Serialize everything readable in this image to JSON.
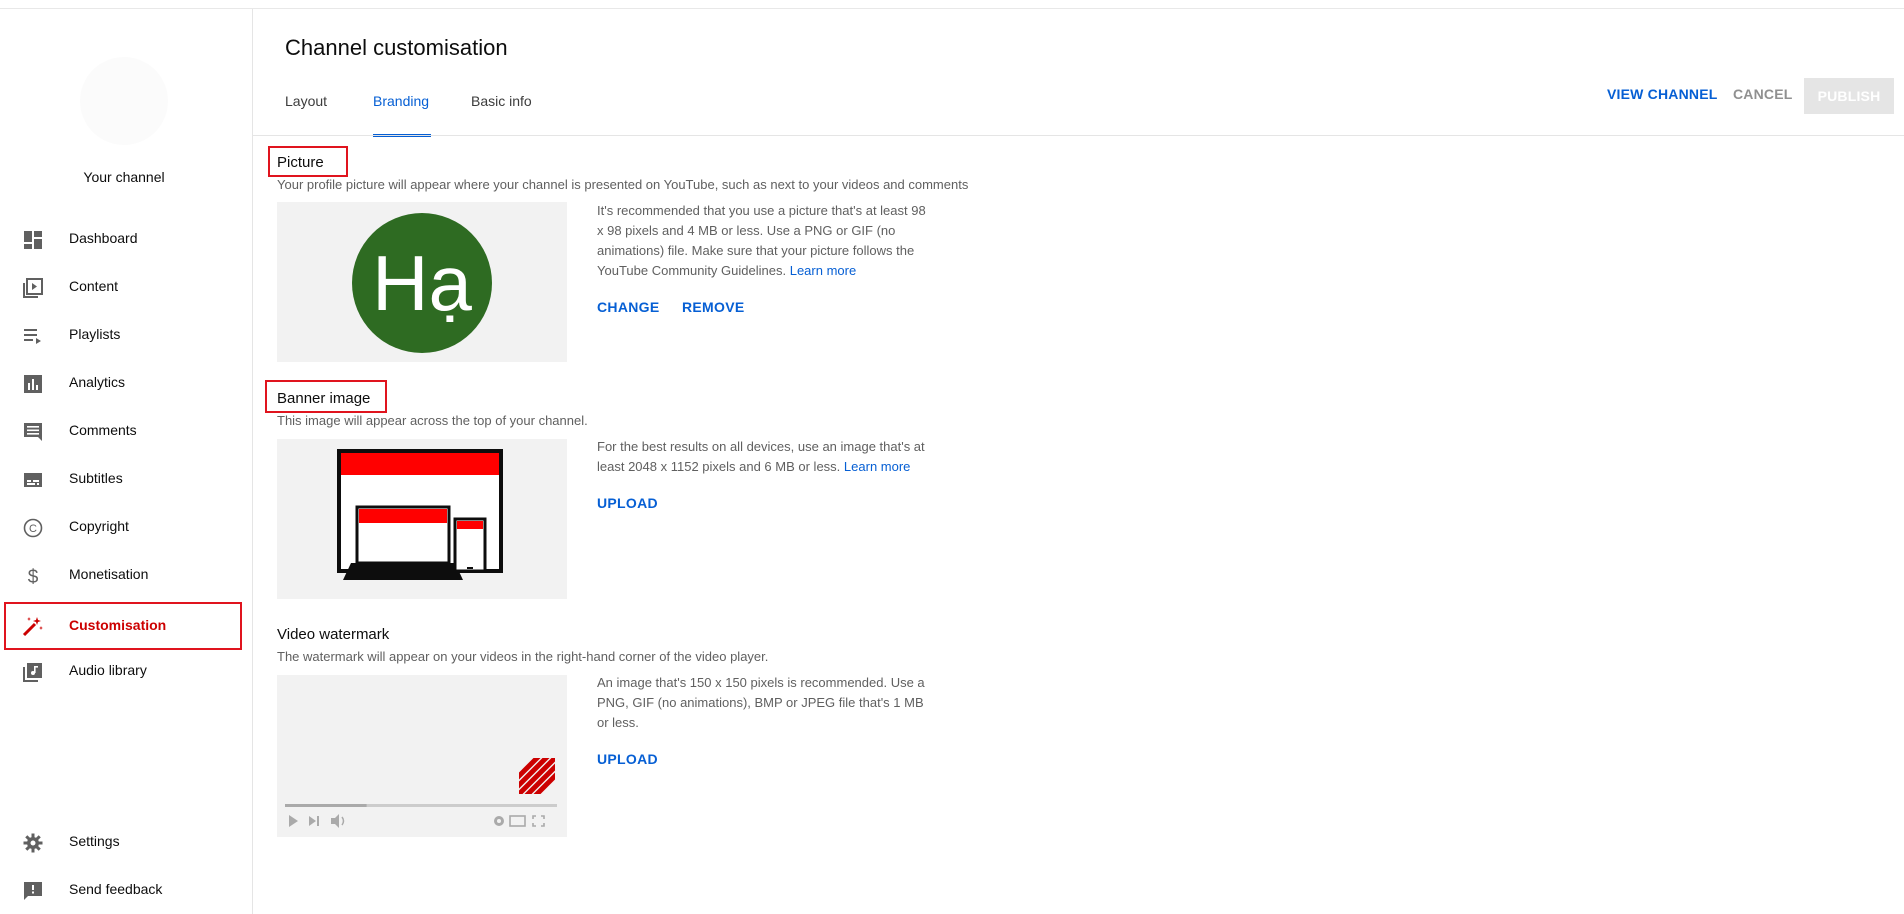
{
  "sidebar": {
    "your_channel": "Your channel",
    "items": [
      {
        "label": "Dashboard",
        "icon": "dashboard-icon"
      },
      {
        "label": "Content",
        "icon": "content-icon"
      },
      {
        "label": "Playlists",
        "icon": "playlists-icon"
      },
      {
        "label": "Analytics",
        "icon": "analytics-icon"
      },
      {
        "label": "Comments",
        "icon": "comments-icon"
      },
      {
        "label": "Subtitles",
        "icon": "subtitles-icon"
      },
      {
        "label": "Copyright",
        "icon": "copyright-icon"
      },
      {
        "label": "Monetisation",
        "icon": "dollar-icon"
      },
      {
        "label": "Customisation",
        "icon": "magic-wand-icon",
        "active": true
      },
      {
        "label": "Audio library",
        "icon": "audio-library-icon"
      }
    ],
    "bottom_items": [
      {
        "label": "Settings",
        "icon": "gear-icon"
      },
      {
        "label": "Send feedback",
        "icon": "feedback-icon"
      }
    ]
  },
  "header": {
    "title": "Channel customisation",
    "tabs": [
      "Layout",
      "Branding",
      "Basic info"
    ],
    "active_tab": "Branding",
    "view_channel": "VIEW CHANNEL",
    "cancel": "CANCEL",
    "publish": "PUBLISH"
  },
  "picture": {
    "title": "Picture",
    "description": "Your profile picture will appear where your channel is presented on YouTube, such as next to your videos and comments",
    "avatar_text": "Hạ",
    "avatar_color": "#2e6b22",
    "info": "It's recommended that you use a picture that's at least 98 x 98 pixels and 4 MB or less. Use a PNG or GIF (no animations) file. Make sure that your picture follows the YouTube Community Guidelines.",
    "learn_more": "Learn more",
    "change": "CHANGE",
    "remove": "REMOVE"
  },
  "banner": {
    "title": "Banner image",
    "description": "This image will appear across the top of your channel.",
    "info": "For the best results on all devices, use an image that's at least 2048 x 1152 pixels and 6 MB or less.",
    "learn_more": "Learn more",
    "upload": "UPLOAD"
  },
  "watermark": {
    "title": "Video watermark",
    "description": "The watermark will appear on your videos in the right-hand corner of the video player.",
    "info": "An image that's 150 x 150 pixels is recommended. Use a PNG, GIF (no animations), BMP or JPEG file that's 1 MB or less.",
    "upload": "UPLOAD",
    "player_progress": 0.3
  },
  "colors": {
    "accent": "#065fd4",
    "active_red": "#cc0000",
    "highlight_box": "#e0141e"
  }
}
